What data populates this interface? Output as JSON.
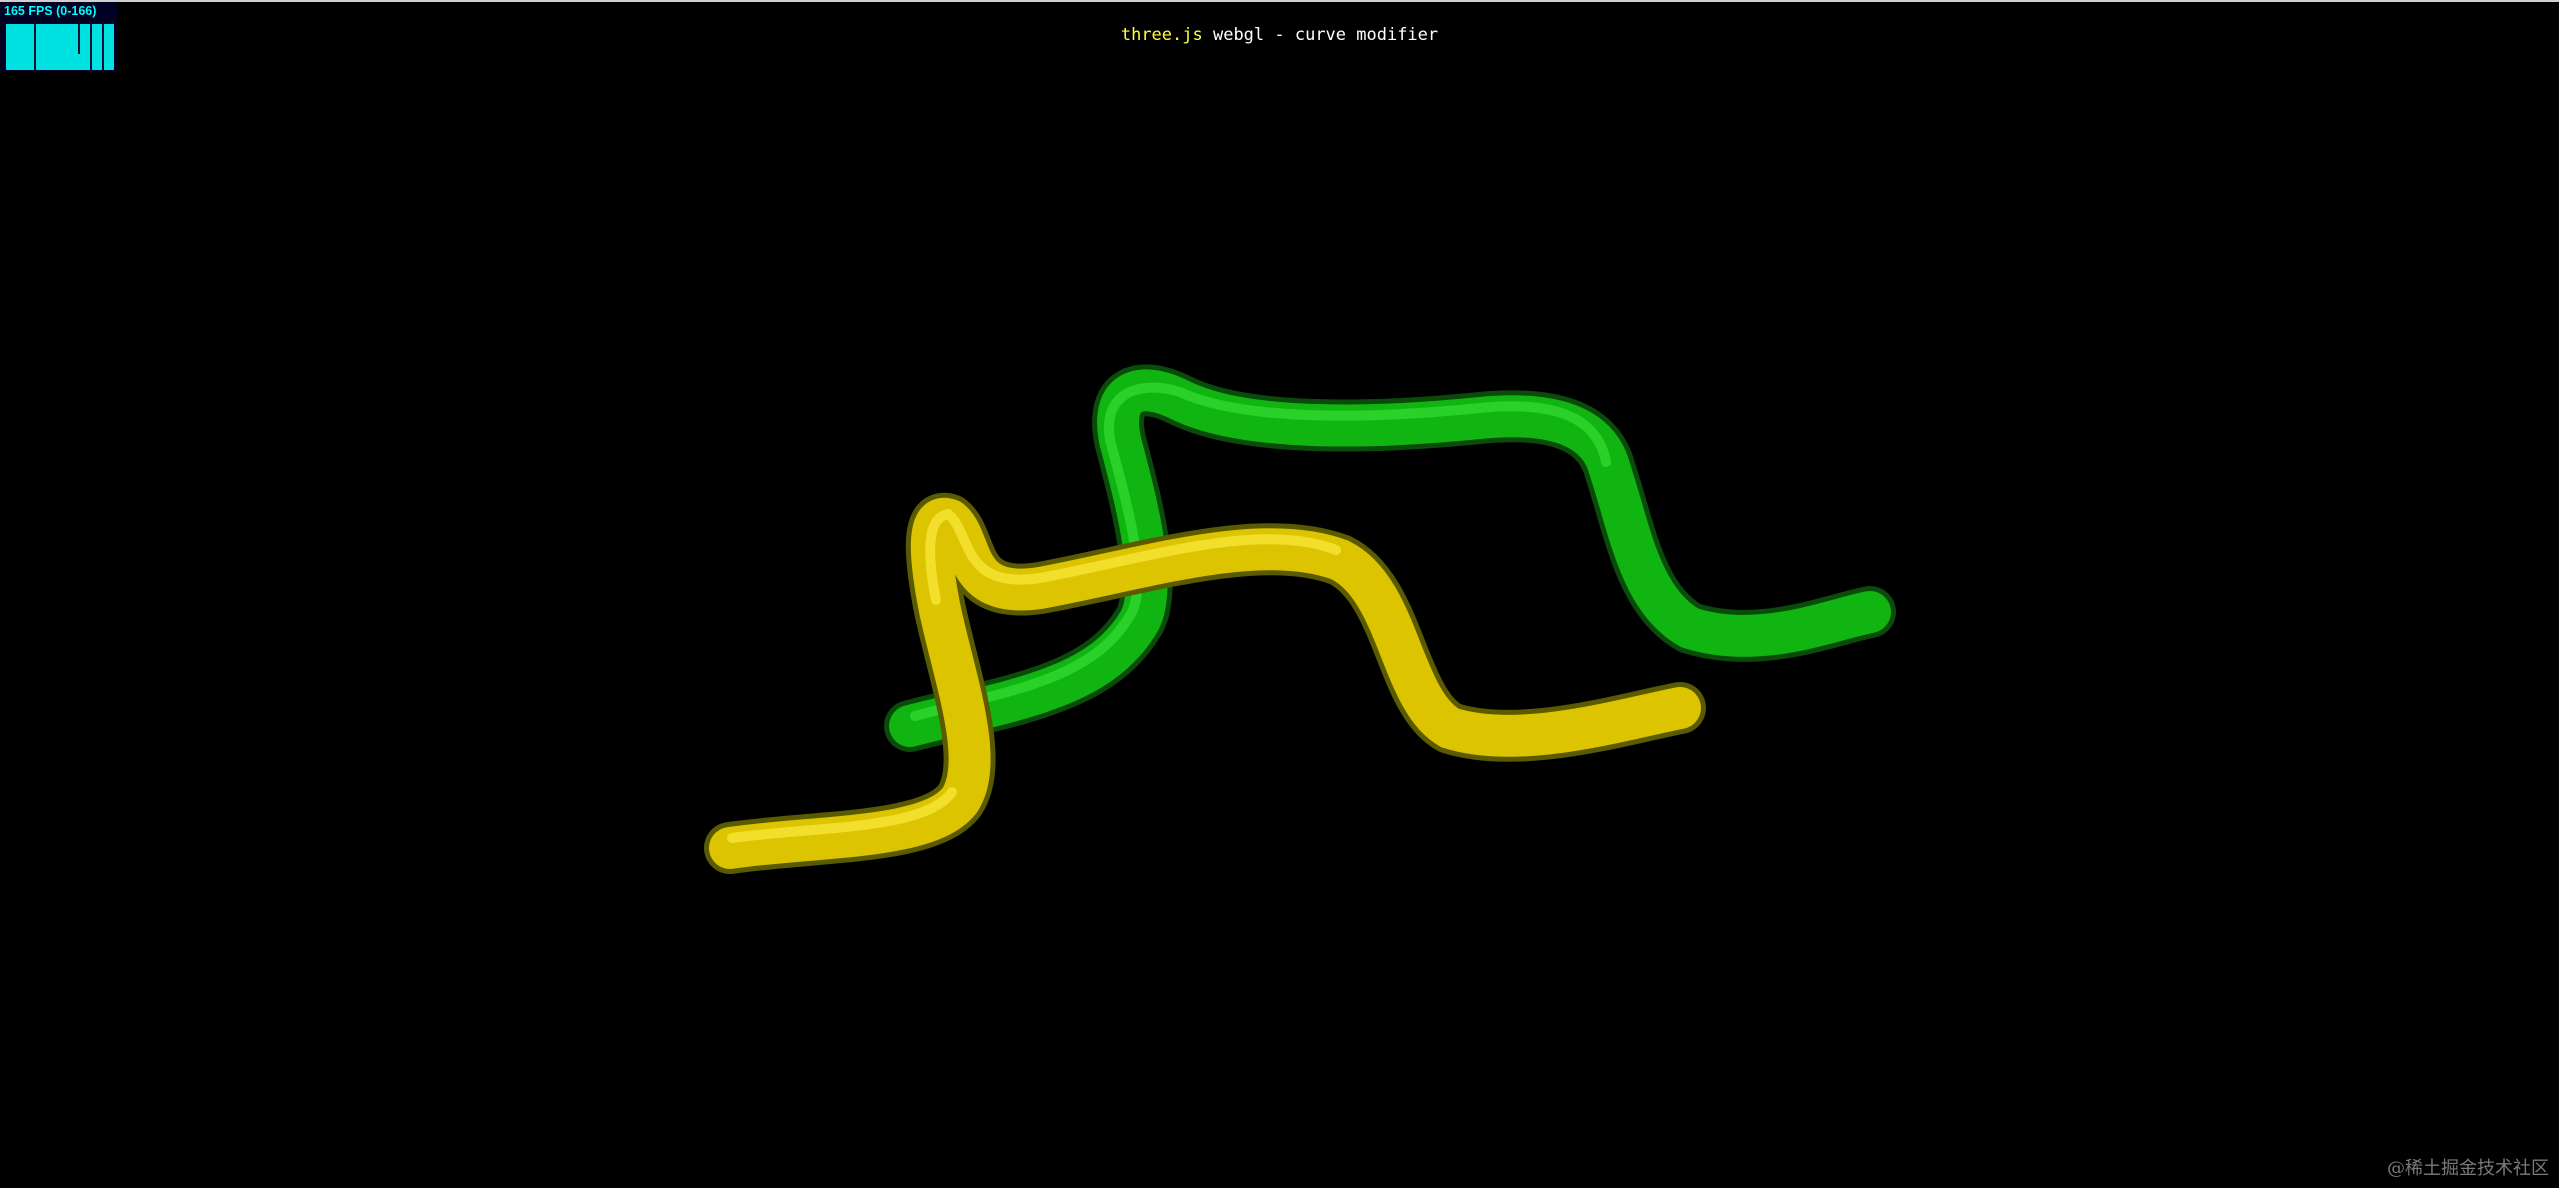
{
  "stats": {
    "fps_label": "165 FPS (0-166)",
    "color": "#00ffff"
  },
  "info": {
    "link_label": "three.js",
    "text": " webgl - curve modifier"
  },
  "scene": {
    "objects": [
      {
        "name": "yellow-tube",
        "color": "#e6cc00"
      },
      {
        "name": "green-tube",
        "color": "#10c010"
      }
    ],
    "background": "#000000"
  },
  "watermark": {
    "text": "@稀土掘金技术社区"
  }
}
